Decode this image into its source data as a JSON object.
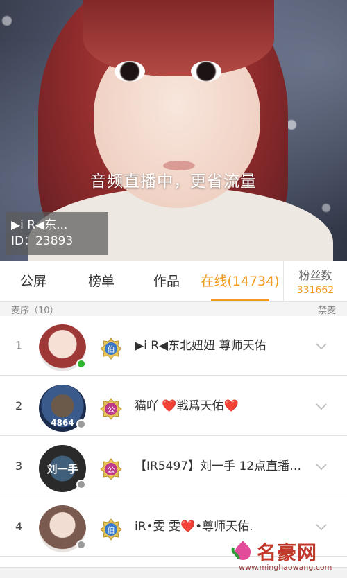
{
  "cover": {
    "caption": "音频直播中，更省流量",
    "anchor_name": "▶i R◀东...",
    "anchor_id": "ID：23893"
  },
  "tabs": [
    {
      "label": "公屏",
      "active": false
    },
    {
      "label": "榜单",
      "active": false
    },
    {
      "label": "作品",
      "active": false
    },
    {
      "label": "在线(14734)",
      "active": true
    }
  ],
  "fans": {
    "label": "粉丝数",
    "count": "331662"
  },
  "queue": {
    "title": "麦序（10）",
    "action": "禁麦"
  },
  "rows": [
    {
      "index": "1",
      "name": "▶i R◀东北妞妞  尊师天佑",
      "badge": "伯",
      "badge_color": "#3a78c9",
      "status_color": "#2db52d"
    },
    {
      "index": "2",
      "name": "猫吖 ❤️戦爲天佑❤️",
      "badge": "公",
      "badge_color": "#c03a8a",
      "status_color": "#9a9a9a",
      "avatar_text": "4864"
    },
    {
      "index": "3",
      "name": "【IR5497】刘一手 12点直播…",
      "badge": "公",
      "badge_color": "#c03a8a",
      "status_color": "#9a9a9a",
      "avatar_text": "刘一手"
    },
    {
      "index": "4",
      "name": "iR•雯 雯❤️•尊师天佑.",
      "badge": "伯",
      "badge_color": "#3a78c9",
      "status_color": "#9a9a9a"
    }
  ],
  "watermark": {
    "title": "名豪网",
    "url": "www.minghaowang.com"
  },
  "colors": {
    "accent": "#f39a1d"
  }
}
